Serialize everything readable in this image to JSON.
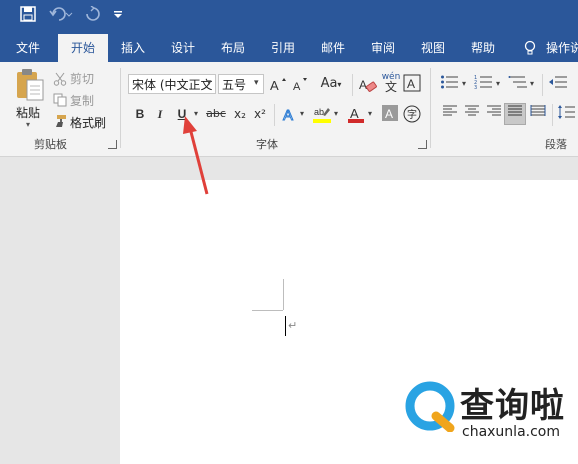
{
  "qat": {
    "save_icon": "save-icon",
    "undo_icon": "undo-icon",
    "redo_icon": "redo-icon",
    "customize_icon": "customize-qat-icon"
  },
  "tabs": [
    "文件",
    "开始",
    "插入",
    "设计",
    "布局",
    "引用",
    "邮件",
    "审阅",
    "视图",
    "帮助"
  ],
  "tell_me": "操作说",
  "clipboard": {
    "paste": "粘贴",
    "cut": "剪切",
    "copy": "复制",
    "format_painter": "格式刷",
    "group_label": "剪贴板"
  },
  "font": {
    "font_name": "宋体 (中文正文",
    "font_size": "五号",
    "change_case": "Aa",
    "bold": "B",
    "italic": "I",
    "underline": "U",
    "strikethrough": "abc",
    "subscript": "x₂",
    "superscript": "x²",
    "phonetic": "wén",
    "enclose": "字",
    "group_label": "字体"
  },
  "paragraph": {
    "group_label": "段落"
  },
  "colors": {
    "accent": "#2b579a",
    "ribbon": "#f3f3f3",
    "arrow": "#e0403a",
    "highlight": "#ffff00",
    "font_color": "#d12a2a"
  },
  "document": {
    "paragraph_mark": "↵"
  },
  "watermark": {
    "name": "查询啦",
    "url": "chaxunla.com"
  }
}
